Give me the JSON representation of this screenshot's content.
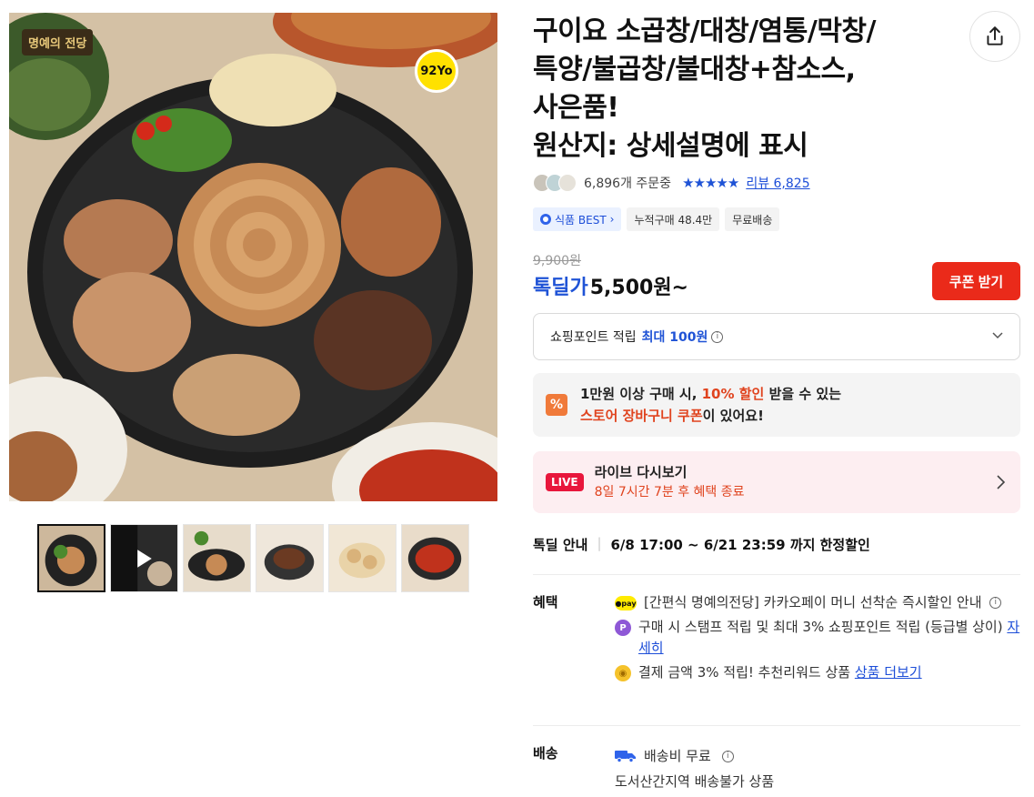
{
  "product": {
    "title_lines": [
      "구이요 소곱창/대창/염통/막창/",
      "특양/불곱창/불대창+참소스,",
      "사은품!",
      "원산지: 상세설명에 표시"
    ],
    "image_brand_badge": "명예의 전당",
    "image_logo": "92Yo"
  },
  "meta": {
    "order_count": "6,896개 주문중",
    "stars": "★★★★★",
    "review_label": "리뷰 6,825"
  },
  "badges": {
    "food_best": "식품 BEST",
    "food_best_chevron": "›",
    "cumulative": "누적구매 48.4만",
    "free_ship": "무료배송"
  },
  "price": {
    "original": "9,900원",
    "sale_label": "톡딜가",
    "sale_price": "5,500원~",
    "coupon_button": "쿠폰 받기"
  },
  "points": {
    "label": "쇼핑포인트 적립",
    "highlight": "최대 100원"
  },
  "promo": {
    "icon": "%",
    "line1_a": "1만원 이상 구매 시, ",
    "line1_hl": "10% 할인",
    "line1_b": " 받을 수 있는",
    "line2_hl": "스토어 장바구니 쿠폰",
    "line2_b": "이 있어요!"
  },
  "live": {
    "tag": "LIVE",
    "title": "라이브 다시보기",
    "subtitle": "8일 7시간 7분 후 혜택 종료"
  },
  "deal": {
    "label": "톡딜 안내",
    "text": "6/8 17:00 ~ 6/21 23:59 까지 한정할인"
  },
  "benefits": {
    "label": "혜택",
    "pay_icon": "●pay",
    "line1": "[간편식 명예의전당] 카카오페이 머니 선착순 즉시할인 안내",
    "p_icon": "P",
    "line2": "구매 시 스탬프 적립 및 최대 3% 쇼핑포인트 적립 (등급별 상이)",
    "line2_link": "자세히",
    "coin_icon": "◉",
    "line3": "결제 금액 3% 적립! 추천리워드 상품",
    "line3_link": "상품 더보기"
  },
  "shipping": {
    "label": "배송",
    "fee": "배송비 무료",
    "note": "도서산간지역 배송불가 상품"
  },
  "info_icon": "i",
  "colors": {
    "accent_blue": "#1f53d6",
    "coupon_red": "#ea2a1a",
    "live_pink": "#e8163c",
    "promo_orange": "#e0441f"
  }
}
